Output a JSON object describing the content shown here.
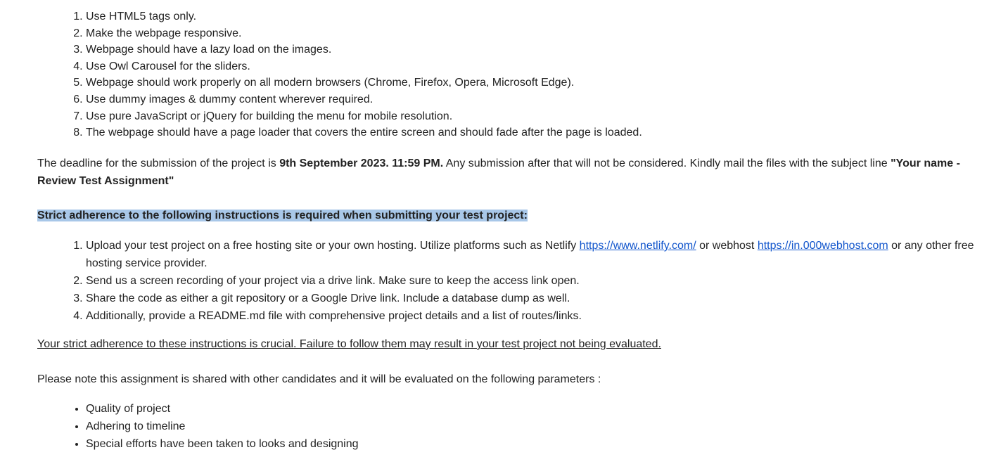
{
  "requirements": [
    "Use HTML5 tags only.",
    "Make the webpage responsive.",
    "Webpage should have a lazy load on the images.",
    "Use Owl Carousel for the sliders.",
    "Webpage should work properly on all modern browsers (Chrome, Firefox, Opera, Microsoft Edge).",
    "Use dummy images & dummy content wherever required.",
    "Use pure JavaScript or jQuery for building the menu for mobile resolution.",
    "The webpage should have a page loader that covers the entire screen and should fade after the page is loaded."
  ],
  "deadline": {
    "prefix": "The deadline for the submission of the project is ",
    "date": "9th September 2023. 11:59 PM.",
    "middle": "  Any submission after that will not be considered. Kindly mail the files with the subject line ",
    "subject": "\"Your name - Review Test Assignment\""
  },
  "strict_heading": "Strict adherence to the following instructions is required when submitting your test project:",
  "instructions": {
    "item1_prefix": "Upload your test project on a free hosting site or your own hosting. Utilize platforms such as Netlify ",
    "netlify_link": "https://www.netlify.com/",
    "item1_middle": " or  webhost ",
    "webhost_link": "https://in.000webhost.com",
    "item1_suffix": " or any other free hosting service provider.",
    "item2": "Send us a screen recording of your project via a drive link. Make sure to keep the access link open.",
    "item3": "Share the code as either a git repository or a Google Drive link. Include a database dump as well.",
    "item4": "Additionally, provide a README.md file with comprehensive project details and a list of routes/links."
  },
  "crucial_note": "Your strict adherence to these instructions is crucial. Failure to follow them may result in your test project not being evaluated.",
  "evaluation_note": "Please note this assignment is shared with other candidates and it will be evaluated on the following parameters :",
  "parameters": [
    "Quality of project",
    "Adhering to timeline",
    "Special efforts have been taken to looks and designing"
  ],
  "colors": {
    "link": "#1155cc",
    "highlight": "#a8c7e8",
    "text": "#222222"
  }
}
